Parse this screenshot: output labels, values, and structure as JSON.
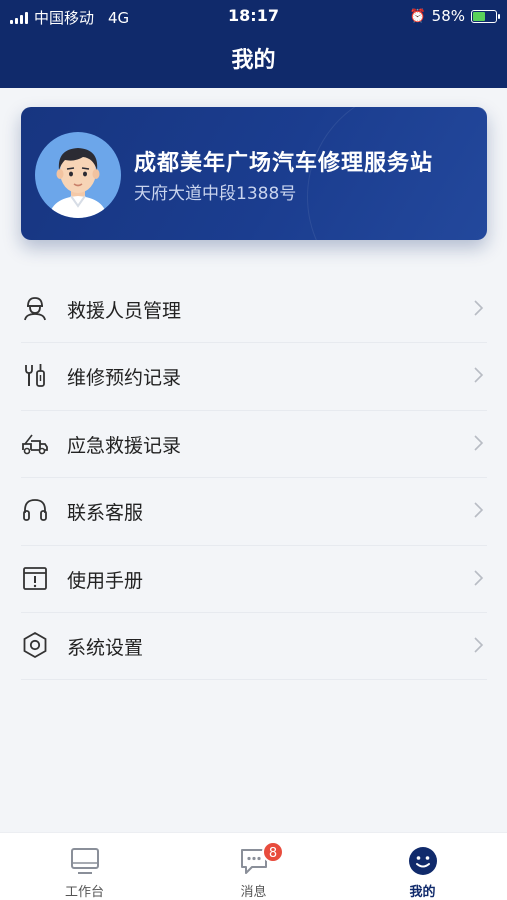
{
  "status_bar": {
    "carrier": "中国移动",
    "network": "4G",
    "time": "18:17",
    "battery": "58%",
    "battery_level": 0.58
  },
  "header": {
    "title": "我的"
  },
  "profile": {
    "store_name": "成都美年广场汽车修理服务站",
    "address": "天府大道中段1388号"
  },
  "menu": {
    "items": [
      {
        "label": "救援人员管理",
        "icon": "worker-helmet-icon"
      },
      {
        "label": "维修预约记录",
        "icon": "wrench-icon"
      },
      {
        "label": "应急救援记录",
        "icon": "tow-truck-icon"
      },
      {
        "label": "联系客服",
        "icon": "headset-icon"
      },
      {
        "label": "使用手册",
        "icon": "manual-icon"
      },
      {
        "label": "系统设置",
        "icon": "hexagon-settings-icon"
      }
    ]
  },
  "tabbar": {
    "tabs": [
      {
        "label": "工作台",
        "icon": "monitor-icon"
      },
      {
        "label": "消息",
        "icon": "message-icon",
        "badge": "8"
      },
      {
        "label": "我的",
        "icon": "smile-icon"
      }
    ]
  },
  "colors": {
    "primary": "#102a6b",
    "badge": "#e84c3d",
    "background": "#f3f5f8"
  }
}
